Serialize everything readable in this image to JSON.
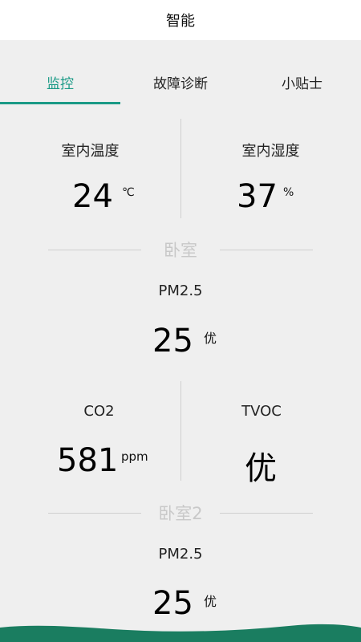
{
  "header": {
    "title": "智能"
  },
  "tabs": [
    {
      "label": "监控",
      "active": true
    },
    {
      "label": "故障诊断",
      "active": false
    },
    {
      "label": "小贴士",
      "active": false
    }
  ],
  "climate": {
    "temperature": {
      "label": "室内温度",
      "value": "24",
      "unit": "℃"
    },
    "humidity": {
      "label": "室内湿度",
      "value": "37",
      "unit": "%"
    }
  },
  "rooms": [
    {
      "name": "卧室",
      "pm25": {
        "label": "PM2.5",
        "value": "25",
        "grade": "优"
      },
      "co2": {
        "label": "CO2",
        "value": "581",
        "unit": "ppm"
      },
      "tvoc": {
        "label": "TVOC",
        "value": "优"
      }
    },
    {
      "name": "卧室2",
      "pm25": {
        "label": "PM2.5",
        "value": "25",
        "grade": "优"
      }
    }
  ],
  "colors": {
    "accent": "#1a9a86",
    "wave": "#1a7d60"
  }
}
